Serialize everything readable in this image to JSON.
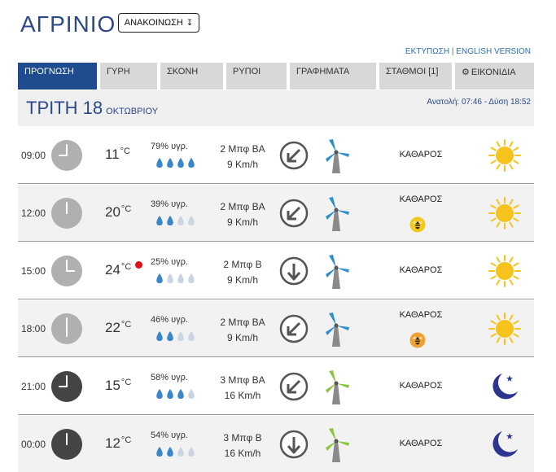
{
  "header": {
    "city": "ΑΓΡΙΝΙΟ",
    "announce_label": "ΑΝΑΚΟΙΝΩΣΗ",
    "announce_icon": "arrow-down-icon",
    "print_link": "ΕΚΤΥΠΩΣΗ",
    "link_separator": "|",
    "english_link": "ENGLISH VERSION"
  },
  "tabs": [
    {
      "label": "ΠΡΟΓΝΩΣΗ",
      "active": true
    },
    {
      "label": "ΓΥΡΗ",
      "active": false
    },
    {
      "label": "ΣΚΟΝΗ",
      "active": false
    },
    {
      "label": "ΡΥΠΟΙ",
      "active": false
    },
    {
      "label": "ΓΡΑΦΗΜΑΤΑ",
      "active": false
    },
    {
      "label": "ΣΤΑΘΜΟΙ [1]",
      "active": false
    },
    {
      "label": "ΕΙΚΟΝΙΔΙΑ",
      "icon": "gear-icon",
      "active": false
    }
  ],
  "day": {
    "name": "ΤΡΙΤΗ 18",
    "month": "ΟΚΤΩΒΡΙΟΥ",
    "sun": "Ανατολή: 07:46 - Δύση 18:52"
  },
  "unit": "°C",
  "rows": [
    {
      "time": "09:00",
      "temp": "11",
      "hum": "79% υγρ.",
      "drops": 4,
      "wind_bf": "2 Μπφ ΒΑ",
      "wind_kmh": "9 Km/h",
      "wind_dir": "NE",
      "sky": "ΚΑΘΑΡΟΣ",
      "pollen": "",
      "icon": "sun-icon",
      "night": false,
      "hot": false
    },
    {
      "time": "12:00",
      "temp": "20",
      "hum": "39% υγρ.",
      "drops": 2,
      "wind_bf": "2 Μπφ ΒΑ",
      "wind_kmh": "9 Km/h",
      "wind_dir": "NE",
      "sky": "ΚΑΘΑΡΟΣ",
      "pollen": "yellow",
      "icon": "sun-icon",
      "night": false,
      "hot": false
    },
    {
      "time": "15:00",
      "temp": "24",
      "hum": "25% υγρ.",
      "drops": 1,
      "wind_bf": "2 Μπφ Β",
      "wind_kmh": "9 Km/h",
      "wind_dir": "N",
      "sky": "ΚΑΘΑΡΟΣ",
      "pollen": "",
      "icon": "sun-icon",
      "night": false,
      "hot": true
    },
    {
      "time": "18:00",
      "temp": "22",
      "hum": "46% υγρ.",
      "drops": 2,
      "wind_bf": "2 Μπφ ΒΑ",
      "wind_kmh": "9 Km/h",
      "wind_dir": "NE",
      "sky": "ΚΑΘΑΡΟΣ",
      "pollen": "orange",
      "icon": "sun-icon",
      "night": false,
      "hot": false
    },
    {
      "time": "21:00",
      "temp": "15",
      "hum": "58% υγρ.",
      "drops": 3,
      "wind_bf": "3 Μπφ ΒΑ",
      "wind_kmh": "16 Km/h",
      "wind_dir": "NE",
      "sky": "ΚΑΘΑΡΟΣ",
      "pollen": "",
      "icon": "moon-icon",
      "night": true,
      "hot": false
    },
    {
      "time": "00:00",
      "temp": "12",
      "hum": "54% υγρ.",
      "drops": 2,
      "wind_bf": "3 Μπφ Β",
      "wind_kmh": "16 Km/h",
      "wind_dir": "N",
      "sky": "ΚΑΘΑΡΟΣ",
      "pollen": "",
      "icon": "moon-icon",
      "night": true,
      "hot": false
    }
  ],
  "colors": {
    "brand_blue": "#1e4c8f",
    "title_blue": "#2c4a8a",
    "tab_gray": "#d8d8d8",
    "drop_full": "#3a86c8",
    "drop_empty": "#c9d6e2",
    "sun": "#f5c31c",
    "moon": "#2d3590",
    "turbine_day": "#2f8fc9",
    "turbine_night": "#8cc63f",
    "hot_dot": "#e0101a"
  }
}
